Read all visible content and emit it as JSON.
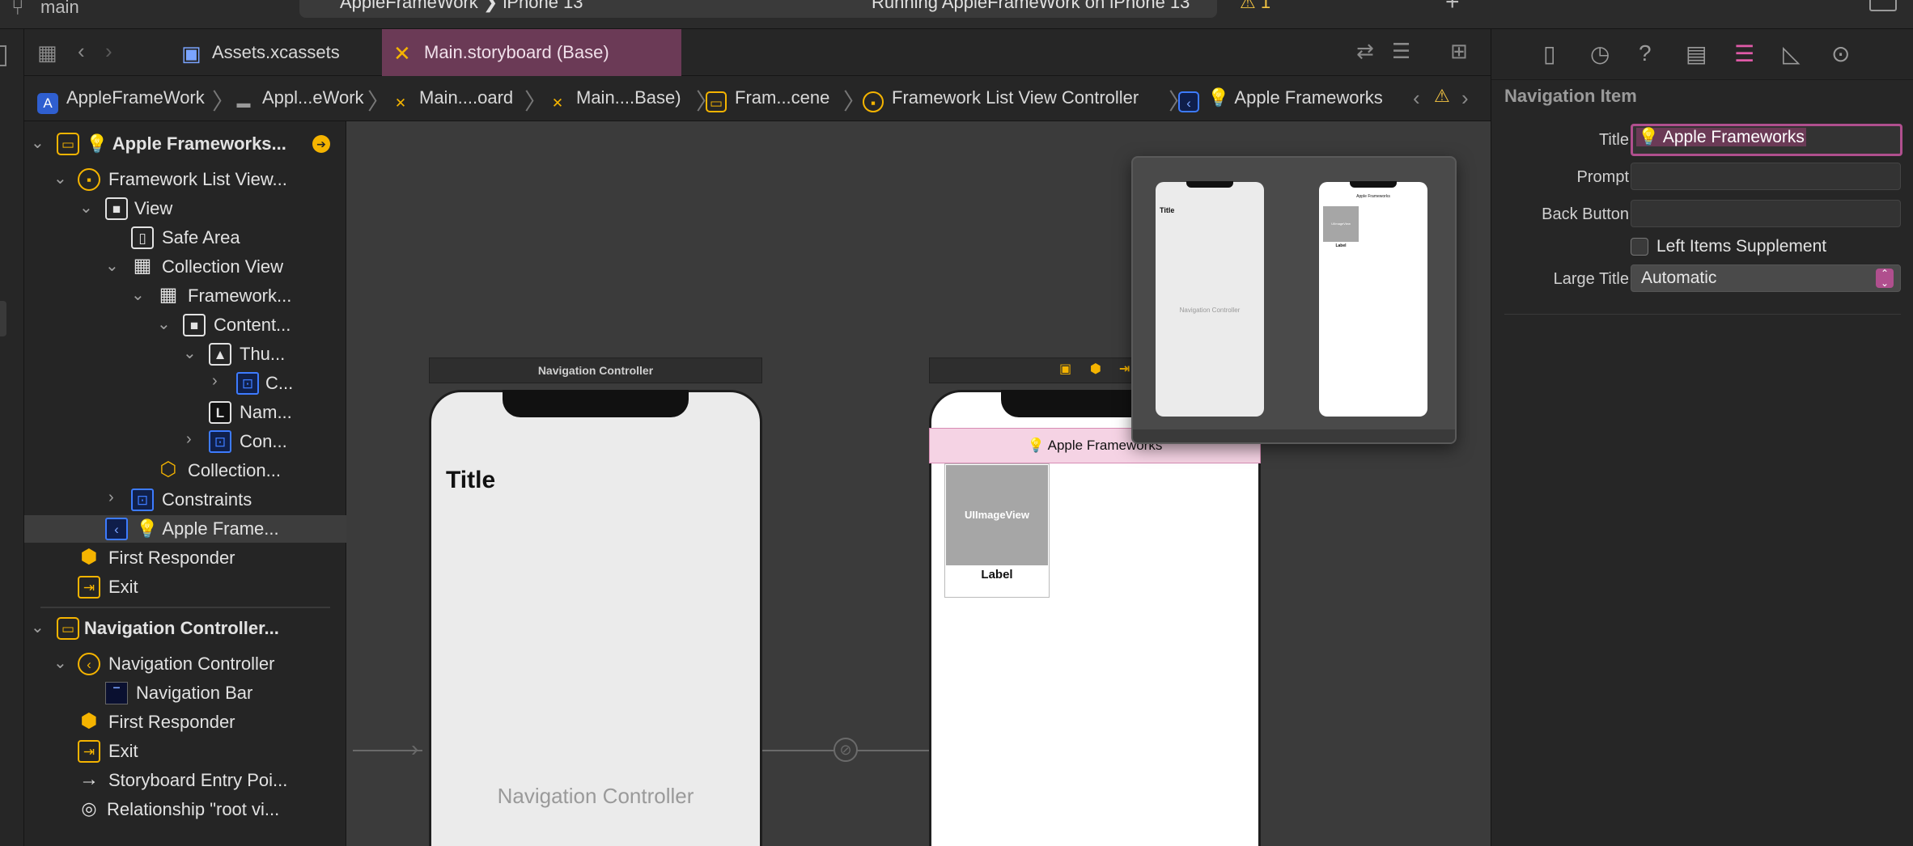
{
  "window": {
    "branch": "main",
    "scheme": "AppleFrameWork",
    "destination": "iPhone 13",
    "status": "Running AppleFrameWork on iPhone 13",
    "warning_count": "1"
  },
  "tabs": [
    {
      "label": "Assets.xcassets"
    },
    {
      "label": "Main.storyboard (Base)"
    }
  ],
  "breadcrumb": [
    "AppleFrameWork",
    "Appl...eWork",
    "Main....oard",
    "Main....Base)",
    "Fram...cene",
    "Framework List View Controller",
    "Apple Frameworks"
  ],
  "outline": {
    "items": [
      {
        "label": "Apple Frameworks..."
      },
      {
        "label": "Framework List View..."
      },
      {
        "label": "View"
      },
      {
        "label": "Safe Area"
      },
      {
        "label": "Collection View"
      },
      {
        "label": "Framework..."
      },
      {
        "label": "Content..."
      },
      {
        "label": "Thu..."
      },
      {
        "label": "C..."
      },
      {
        "label": "Nam..."
      },
      {
        "label": "Con..."
      },
      {
        "label": "Collection..."
      },
      {
        "label": "Constraints"
      },
      {
        "label": "Apple Frame..."
      },
      {
        "label": "First Responder"
      },
      {
        "label": "Exit"
      },
      {
        "label": "Navigation Controller..."
      },
      {
        "label": "Navigation Controller"
      },
      {
        "label": "Navigation Bar"
      },
      {
        "label": "First Responder"
      },
      {
        "label": "Exit"
      },
      {
        "label": "Storyboard Entry Poi..."
      },
      {
        "label": "Relationship \"root vi..."
      }
    ]
  },
  "canvas": {
    "nav_scene_title": "Navigation Controller",
    "nav_large_title": "Title",
    "nav_placeholder": "Navigation Controller",
    "list_nav_title": "Apple Frameworks",
    "imageview_label": "UIImageView",
    "cell_label": "Label",
    "minimap_title": "Title",
    "minimap_nav_label": "Navigation Controller",
    "minimap_list_title": "Apple Frameworks",
    "minimap_imageview": "UIImageView",
    "minimap_label": "Label"
  },
  "inspector": {
    "section_title": "Navigation Item",
    "title_label": "Title",
    "title_value": "Apple Frameworks",
    "prompt_label": "Prompt",
    "prompt_value": "",
    "back_button_label": "Back Button",
    "back_button_value": "",
    "left_items_supplement_label": "Left Items Supplement",
    "left_items_supplement_checked": false,
    "large_title_label": "Large Title",
    "large_title_value": "Automatic"
  },
  "colors": {
    "accent": "#e05aa8",
    "selection": "#6b3a56",
    "nav_highlight": "#f5d3e4"
  }
}
